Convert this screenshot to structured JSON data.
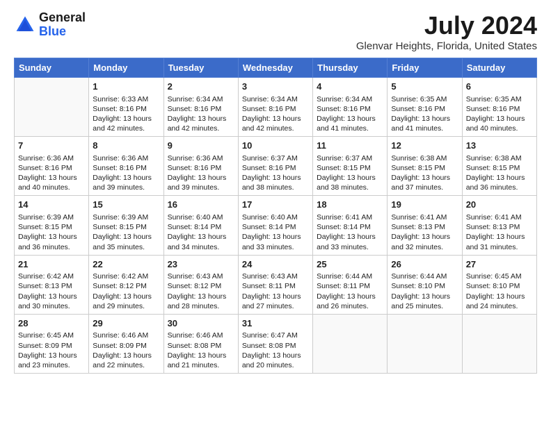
{
  "header": {
    "logo_line1": "General",
    "logo_line2": "Blue",
    "month_year": "July 2024",
    "location": "Glenvar Heights, Florida, United States"
  },
  "days_of_week": [
    "Sunday",
    "Monday",
    "Tuesday",
    "Wednesday",
    "Thursday",
    "Friday",
    "Saturday"
  ],
  "weeks": [
    [
      {
        "day": "",
        "sunrise": "",
        "sunset": "",
        "daylight": ""
      },
      {
        "day": "1",
        "sunrise": "Sunrise: 6:33 AM",
        "sunset": "Sunset: 8:16 PM",
        "daylight": "Daylight: 13 hours and 42 minutes."
      },
      {
        "day": "2",
        "sunrise": "Sunrise: 6:34 AM",
        "sunset": "Sunset: 8:16 PM",
        "daylight": "Daylight: 13 hours and 42 minutes."
      },
      {
        "day": "3",
        "sunrise": "Sunrise: 6:34 AM",
        "sunset": "Sunset: 8:16 PM",
        "daylight": "Daylight: 13 hours and 42 minutes."
      },
      {
        "day": "4",
        "sunrise": "Sunrise: 6:34 AM",
        "sunset": "Sunset: 8:16 PM",
        "daylight": "Daylight: 13 hours and 41 minutes."
      },
      {
        "day": "5",
        "sunrise": "Sunrise: 6:35 AM",
        "sunset": "Sunset: 8:16 PM",
        "daylight": "Daylight: 13 hours and 41 minutes."
      },
      {
        "day": "6",
        "sunrise": "Sunrise: 6:35 AM",
        "sunset": "Sunset: 8:16 PM",
        "daylight": "Daylight: 13 hours and 40 minutes."
      }
    ],
    [
      {
        "day": "7",
        "sunrise": "Sunrise: 6:36 AM",
        "sunset": "Sunset: 8:16 PM",
        "daylight": "Daylight: 13 hours and 40 minutes."
      },
      {
        "day": "8",
        "sunrise": "Sunrise: 6:36 AM",
        "sunset": "Sunset: 8:16 PM",
        "daylight": "Daylight: 13 hours and 39 minutes."
      },
      {
        "day": "9",
        "sunrise": "Sunrise: 6:36 AM",
        "sunset": "Sunset: 8:16 PM",
        "daylight": "Daylight: 13 hours and 39 minutes."
      },
      {
        "day": "10",
        "sunrise": "Sunrise: 6:37 AM",
        "sunset": "Sunset: 8:16 PM",
        "daylight": "Daylight: 13 hours and 38 minutes."
      },
      {
        "day": "11",
        "sunrise": "Sunrise: 6:37 AM",
        "sunset": "Sunset: 8:15 PM",
        "daylight": "Daylight: 13 hours and 38 minutes."
      },
      {
        "day": "12",
        "sunrise": "Sunrise: 6:38 AM",
        "sunset": "Sunset: 8:15 PM",
        "daylight": "Daylight: 13 hours and 37 minutes."
      },
      {
        "day": "13",
        "sunrise": "Sunrise: 6:38 AM",
        "sunset": "Sunset: 8:15 PM",
        "daylight": "Daylight: 13 hours and 36 minutes."
      }
    ],
    [
      {
        "day": "14",
        "sunrise": "Sunrise: 6:39 AM",
        "sunset": "Sunset: 8:15 PM",
        "daylight": "Daylight: 13 hours and 36 minutes."
      },
      {
        "day": "15",
        "sunrise": "Sunrise: 6:39 AM",
        "sunset": "Sunset: 8:15 PM",
        "daylight": "Daylight: 13 hours and 35 minutes."
      },
      {
        "day": "16",
        "sunrise": "Sunrise: 6:40 AM",
        "sunset": "Sunset: 8:14 PM",
        "daylight": "Daylight: 13 hours and 34 minutes."
      },
      {
        "day": "17",
        "sunrise": "Sunrise: 6:40 AM",
        "sunset": "Sunset: 8:14 PM",
        "daylight": "Daylight: 13 hours and 33 minutes."
      },
      {
        "day": "18",
        "sunrise": "Sunrise: 6:41 AM",
        "sunset": "Sunset: 8:14 PM",
        "daylight": "Daylight: 13 hours and 33 minutes."
      },
      {
        "day": "19",
        "sunrise": "Sunrise: 6:41 AM",
        "sunset": "Sunset: 8:13 PM",
        "daylight": "Daylight: 13 hours and 32 minutes."
      },
      {
        "day": "20",
        "sunrise": "Sunrise: 6:41 AM",
        "sunset": "Sunset: 8:13 PM",
        "daylight": "Daylight: 13 hours and 31 minutes."
      }
    ],
    [
      {
        "day": "21",
        "sunrise": "Sunrise: 6:42 AM",
        "sunset": "Sunset: 8:13 PM",
        "daylight": "Daylight: 13 hours and 30 minutes."
      },
      {
        "day": "22",
        "sunrise": "Sunrise: 6:42 AM",
        "sunset": "Sunset: 8:12 PM",
        "daylight": "Daylight: 13 hours and 29 minutes."
      },
      {
        "day": "23",
        "sunrise": "Sunrise: 6:43 AM",
        "sunset": "Sunset: 8:12 PM",
        "daylight": "Daylight: 13 hours and 28 minutes."
      },
      {
        "day": "24",
        "sunrise": "Sunrise: 6:43 AM",
        "sunset": "Sunset: 8:11 PM",
        "daylight": "Daylight: 13 hours and 27 minutes."
      },
      {
        "day": "25",
        "sunrise": "Sunrise: 6:44 AM",
        "sunset": "Sunset: 8:11 PM",
        "daylight": "Daylight: 13 hours and 26 minutes."
      },
      {
        "day": "26",
        "sunrise": "Sunrise: 6:44 AM",
        "sunset": "Sunset: 8:10 PM",
        "daylight": "Daylight: 13 hours and 25 minutes."
      },
      {
        "day": "27",
        "sunrise": "Sunrise: 6:45 AM",
        "sunset": "Sunset: 8:10 PM",
        "daylight": "Daylight: 13 hours and 24 minutes."
      }
    ],
    [
      {
        "day": "28",
        "sunrise": "Sunrise: 6:45 AM",
        "sunset": "Sunset: 8:09 PM",
        "daylight": "Daylight: 13 hours and 23 minutes."
      },
      {
        "day": "29",
        "sunrise": "Sunrise: 6:46 AM",
        "sunset": "Sunset: 8:09 PM",
        "daylight": "Daylight: 13 hours and 22 minutes."
      },
      {
        "day": "30",
        "sunrise": "Sunrise: 6:46 AM",
        "sunset": "Sunset: 8:08 PM",
        "daylight": "Daylight: 13 hours and 21 minutes."
      },
      {
        "day": "31",
        "sunrise": "Sunrise: 6:47 AM",
        "sunset": "Sunset: 8:08 PM",
        "daylight": "Daylight: 13 hours and 20 minutes."
      },
      {
        "day": "",
        "sunrise": "",
        "sunset": "",
        "daylight": ""
      },
      {
        "day": "",
        "sunrise": "",
        "sunset": "",
        "daylight": ""
      },
      {
        "day": "",
        "sunrise": "",
        "sunset": "",
        "daylight": ""
      }
    ]
  ]
}
